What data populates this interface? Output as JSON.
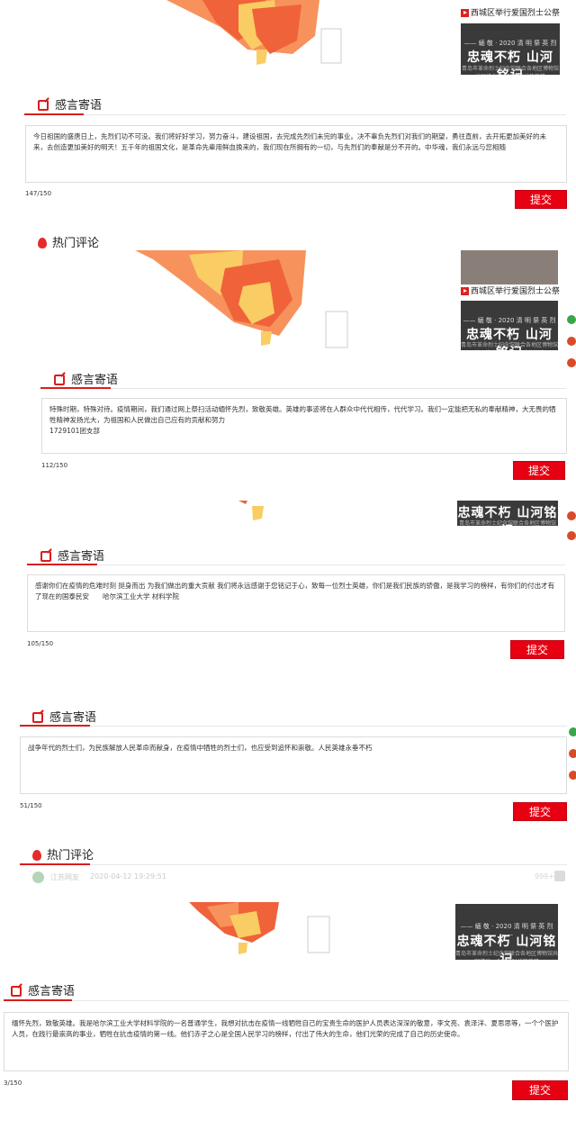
{
  "thumb_caption": "西城区举行爱国烈士公祭活动",
  "thumb": {
    "line": "—— 緬 敬 · 2020 清 明 祭 英 烈 ——",
    "big": "忠魂不朽 山河铭记",
    "sub": "青岛市革命烈士纪念馆联合各地区博物馆共同推出 · 全国新时代的英雄"
  },
  "section_title": "感言寄语",
  "hot_title": "热门评论",
  "submit_label": "提交",
  "blocks": [
    {
      "text": "今日祖国的盛唐日上，先烈们功不可没。我们将好好学习，努力奋斗，建设祖国，去完成先烈们未完的事业。决不辜负先烈们对我们的期望，勇往直前，去开拓更加美好的未来，去创造更加美好的明天！五千年的祖国文化，是革命先辈用鲜血换来的，我们现在所拥有的一切，与先烈们的奉献是分不开的。中华魂，我们永远与您相随",
      "count": "147/150"
    },
    {
      "text": "特殊时期，特殊对待。疫情期间，我们通过网上祭扫活动缅怀先烈，致敬英雄。英雄的事迹将在人群众中代代相传，代代学习。我们一定能把无私的奉献精神，大无畏的牺牲精神发扬光大，为祖国和人民做出自己应有的贡献和努力\n1729101团支部",
      "count": "112/150"
    },
    {
      "text": "感谢你们在疫情的危难时刻 挺身而出 为我们做出的重大贡献 我们将永远感谢于您铭记于心，致每一位烈士英雄，你们是我们民族的骄傲，是我学习的榜样，有你们的付出才有了现在的国泰民安　　哈尔滨工业大学 材料学院",
      "count": "105/150"
    },
    {
      "text": "战争年代的烈士们，为民族解放人民革命而献身，在疫情中牺牲的烈士们，也应受到追怀和崇敬。人民英雄永垂不朽",
      "count": "51/150"
    },
    {
      "text": "缅怀先烈，致敬英雄。我是哈尔滨工业大学材料学院的一名普通学生，我想对抗击在疫情一线牺牲自己的宝贵生命的医护人员表达深深的敬意，李文亮、袁泽洋、夏思思等，一个个医护人员，在践行最崇高的事业，牺牲在抗击疫情的第一线。他们赤子之心是全国人民学习的榜样，付出了伟大的生命，他们光荣的完成了自己的历史使命。",
      "count": "3/150"
    }
  ],
  "comment": {
    "user": "江苏网友",
    "time": "2020-04-12 19:29:51",
    "likes": "999+"
  },
  "colors": {
    "accent": "#d81e1e",
    "button": "#e60012",
    "map_red": "#f0623a",
    "map_orange": "#f7925d",
    "map_yellow": "#f9cd63"
  }
}
